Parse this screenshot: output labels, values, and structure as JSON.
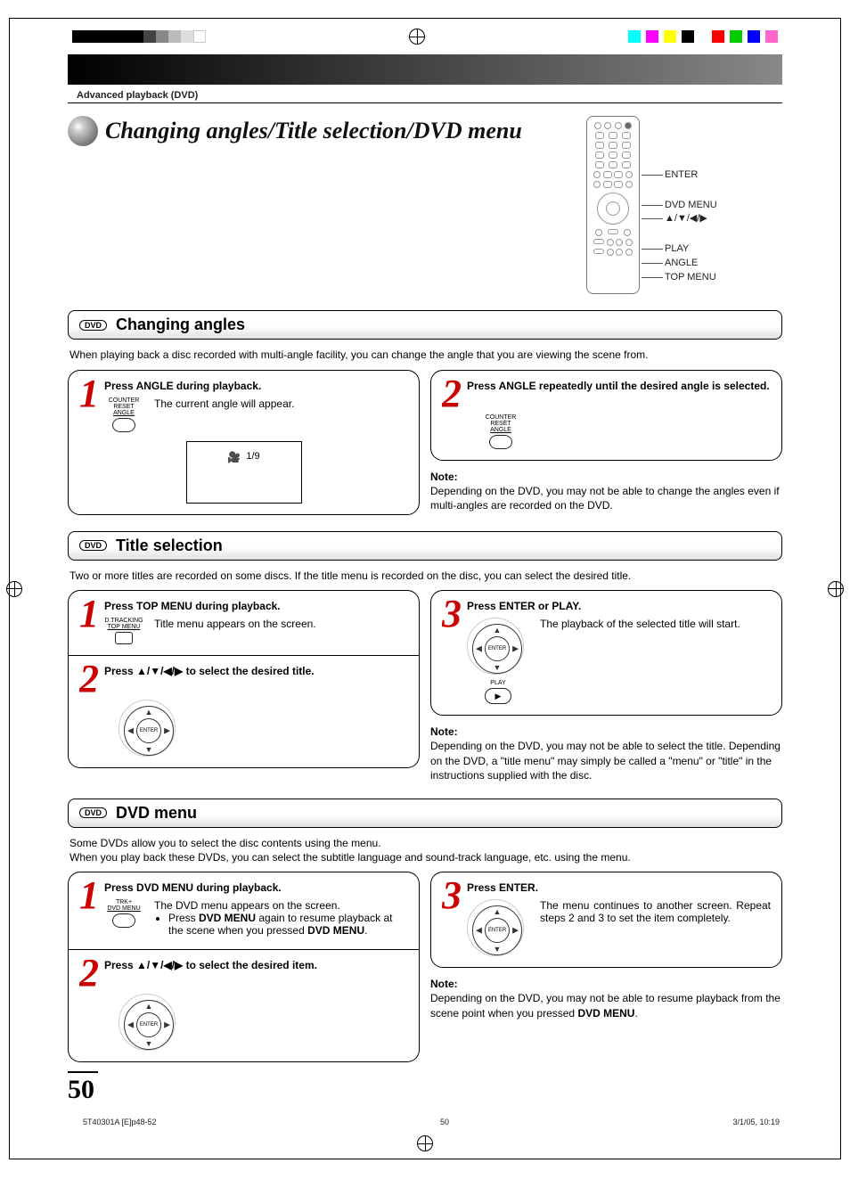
{
  "breadcrumb": "Advanced playback (DVD)",
  "page_title": "Changing angles/Title selection/DVD menu",
  "remote_labels": {
    "enter": "ENTER",
    "dvd_menu": "DVD MENU",
    "arrows": "▲/▼/◀/▶",
    "play": "PLAY",
    "angle": "ANGLE",
    "top_menu": "TOP MENU"
  },
  "dvd_badge": "DVD",
  "sections": {
    "angles": {
      "heading": "Changing angles",
      "intro": "When playing back a disc recorded with multi-angle facility, you can change the angle that you are viewing the scene from.",
      "step1": {
        "num": "1",
        "title": "Press ANGLE during playback.",
        "body": "The current angle will appear.",
        "button_label_l1": "COUNTER RESET",
        "button_label_l2": "ANGLE",
        "osd_value": "1/9"
      },
      "step2": {
        "num": "2",
        "title": "Press ANGLE repeatedly until the desired angle is selected.",
        "button_label_l1": "COUNTER RESET",
        "button_label_l2": "ANGLE"
      },
      "note": {
        "head": "Note:",
        "body": "Depending on the DVD, you may not be able to change the angles even if multi-angles are recorded on the DVD."
      }
    },
    "title": {
      "heading": "Title selection",
      "intro": "Two or more titles are recorded on some discs. If the title menu is recorded on the disc, you can select the desired title.",
      "step1": {
        "num": "1",
        "title": "Press TOP MENU during playback.",
        "body": "Title menu appears on the screen.",
        "button_label_l1": "D.TRACKING",
        "button_label_l2": "TOP MENU"
      },
      "step2": {
        "num": "2",
        "title_pre": "Press ",
        "title_arrows": "▲/▼/◀/▶",
        "title_post": " to select the desired title.",
        "enter_label": "ENTER"
      },
      "step3": {
        "num": "3",
        "title": "Press ENTER or PLAY.",
        "body": "The playback of the selected title will start.",
        "enter_label": "ENTER",
        "play_label": "PLAY"
      },
      "note": {
        "head": "Note:",
        "body": "Depending on the DVD, you may not be able to select the title. Depending on the DVD, a \"title menu\" may simply be called a \"menu\" or \"title\" in the instructions supplied with the disc."
      }
    },
    "dvdmenu": {
      "heading": "DVD menu",
      "intro_l1": "Some DVDs allow you to select the disc contents using the menu.",
      "intro_l2": "When you play back these DVDs, you can select the subtitle language and sound-track language, etc. using the menu.",
      "step1": {
        "num": "1",
        "title": "Press DVD MENU during playback.",
        "body_l1": "The DVD menu appears on the screen.",
        "bullet_pre": "Press ",
        "bullet_bold": "DVD MENU",
        "bullet_post_l1": " again to resume playback at the scene when you pressed ",
        "bullet_bold2": "DVD MENU",
        "bullet_post_l2": ".",
        "button_label_l1": "TRK+",
        "button_label_l2": "DVD MENU"
      },
      "step2": {
        "num": "2",
        "title_pre": "Press ",
        "title_arrows": "▲/▼/◀/▶",
        "title_post": " to select the desired item.",
        "enter_label": "ENTER"
      },
      "step3": {
        "num": "3",
        "title": "Press ENTER.",
        "body": "The menu continues to another screen. Repeat steps 2 and 3 to set the item completely.",
        "enter_label": "ENTER"
      },
      "note": {
        "head": "Note:",
        "body_pre": "Depending on the DVD, you may not be able to resume playback from the scene point when you pressed ",
        "body_bold": "DVD MENU",
        "body_post": "."
      }
    }
  },
  "page_number": "50",
  "footer": {
    "left": "5T40301A [E]p48-52",
    "center": "50",
    "right": "3/1/05, 10:19"
  }
}
